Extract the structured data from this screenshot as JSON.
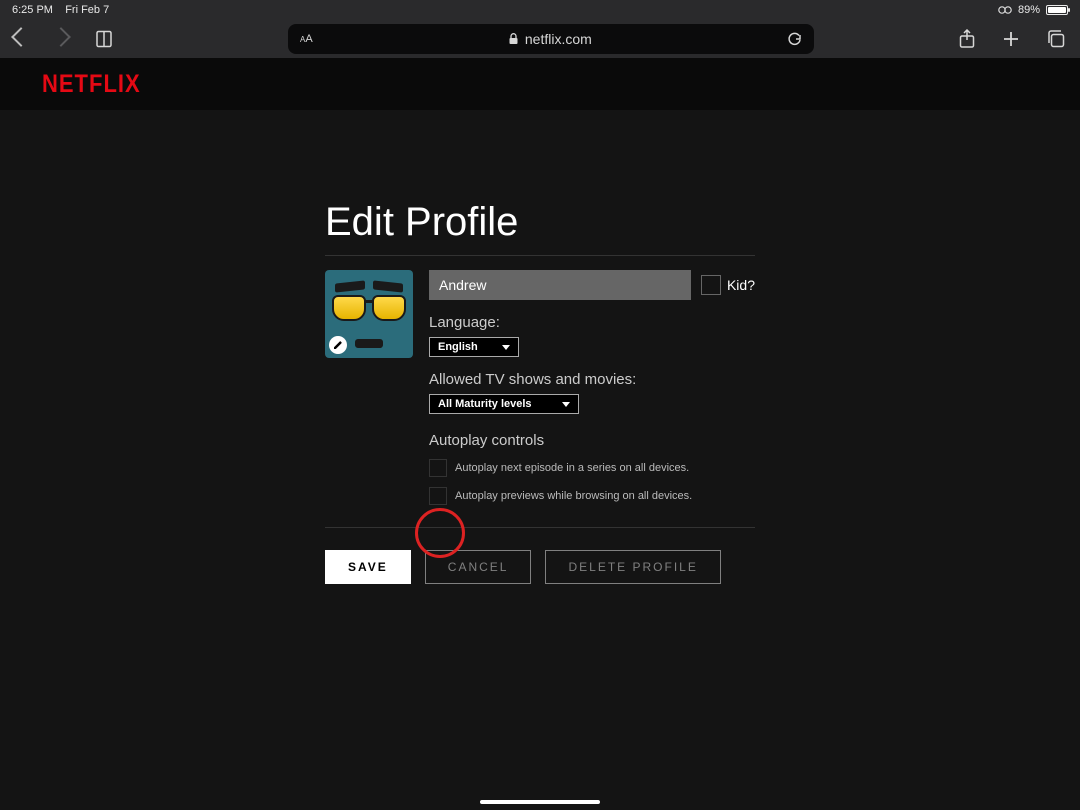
{
  "status": {
    "time": "6:25 PM",
    "date": "Fri Feb 7",
    "battery_pct": "89%"
  },
  "browser": {
    "url_display": "netflix.com",
    "reader_aA": "AA"
  },
  "header": {
    "logo_text": "NETFLIX"
  },
  "page": {
    "title": "Edit Profile",
    "name_value": "Andrew",
    "kid_label": "Kid?",
    "language_label": "Language:",
    "language_value": "English",
    "maturity_label": "Allowed TV shows and movies:",
    "maturity_value": "All Maturity levels",
    "autoplay_label": "Autoplay controls",
    "autoplay_next": "Autoplay next episode in a series on all devices.",
    "autoplay_previews": "Autoplay previews while browsing on all devices."
  },
  "actions": {
    "save": "SAVE",
    "cancel": "CANCEL",
    "delete": "DELETE PROFILE"
  }
}
